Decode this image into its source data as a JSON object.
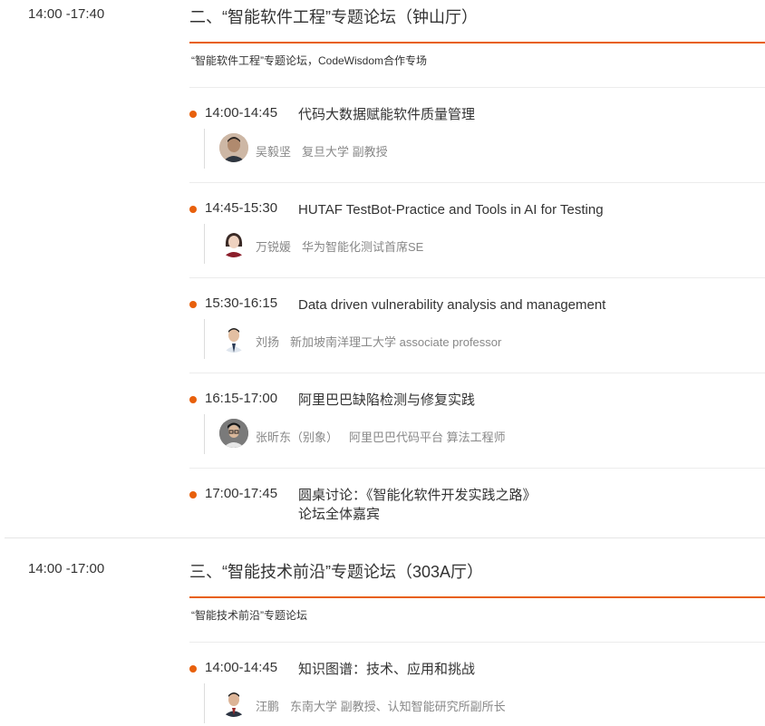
{
  "forums": [
    {
      "time": "14:00 -17:40",
      "title": "二、“智能软件工程”专题论坛（钟山厅）",
      "subtitle": "“智能软件工程”专题论坛，CodeWisdom合作专场",
      "sessions": [
        {
          "time": "14:00-14:45",
          "title": "代码大数据赋能软件质量管理",
          "speaker": "吴毅坚",
          "org": "复旦大学 副教授"
        },
        {
          "time": "14:45-15:30",
          "title": "HUTAF  TestBot-Practice and Tools in AI for Testing",
          "speaker": "万锐媛",
          "org": "华为智能化测试首席SE"
        },
        {
          "time": "15:30-16:15",
          "title": "Data  driven vulnerability analysis and management",
          "speaker": "刘扬",
          "org": "新加坡南洋理工大学 associate professor"
        },
        {
          "time": "16:15-17:00",
          "title": "阿里巴巴缺陷检测与修复实践",
          "speaker": "张昕东（别象）",
          "org": "阿里巴巴代码平台 算法工程师"
        },
        {
          "time": "17:00-17:45",
          "title": "圆桌讨论：《智能化软件开发实践之路》",
          "title2": "论坛全体嘉宾"
        }
      ]
    },
    {
      "time": "14:00 -17:00",
      "title": "三、“智能技术前沿”专题论坛（303A厅）",
      "subtitle": "“智能技术前沿”专题论坛",
      "sessions": [
        {
          "time": "14:00-14:45",
          "title": "知识图谱：技术、应用和挑战",
          "speaker": "汪鹏",
          "org": "东南大学 副教授、认知智能研究所副所长"
        }
      ]
    }
  ],
  "colors": {
    "accent": "#e8600c",
    "text": "#333333",
    "muted": "#888888"
  },
  "icons": {
    "bullet": "orange-dot-icon",
    "avatar": "speaker-avatar"
  }
}
